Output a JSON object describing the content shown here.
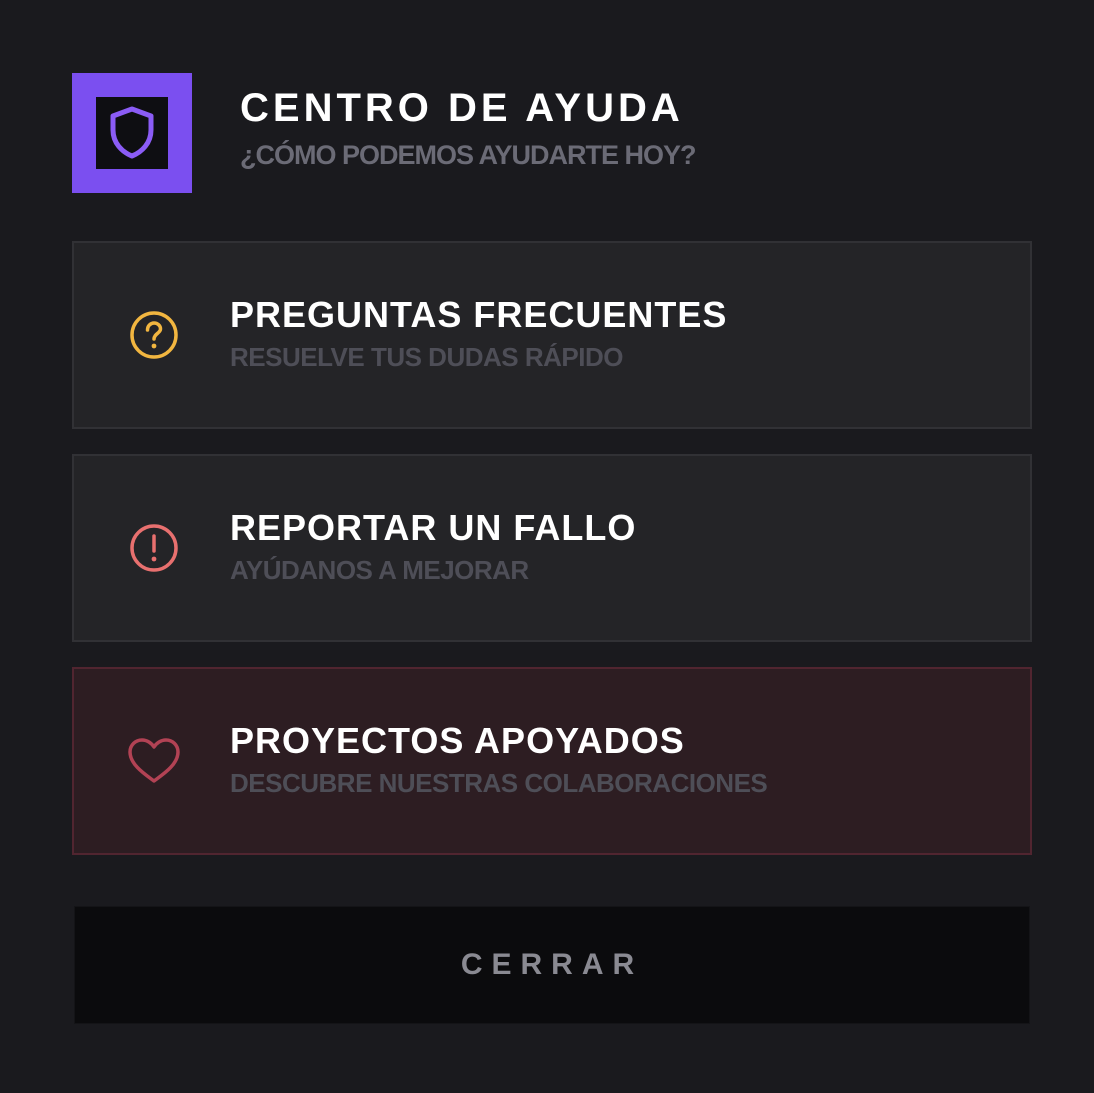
{
  "header": {
    "logo_icon": "shield-icon",
    "title": "CENTRO DE AYUDA",
    "subtitle": "¿CÓMO PODEMOS AYUDARTE HOY?"
  },
  "options": [
    {
      "icon": "question-circle-icon",
      "icon_color": "#f2b640",
      "title": "PREGUNTAS FRECUENTES",
      "description": "RESUELVE TUS DUDAS RÁPIDO"
    },
    {
      "icon": "alert-circle-icon",
      "icon_color": "#e8706f",
      "title": "REPORTAR UN FALLO",
      "description": "AYÚDANOS A MEJORAR"
    },
    {
      "icon": "heart-icon",
      "icon_color": "#b24254",
      "title": "PROYECTOS APOYADOS",
      "description": "DESCUBRE NUESTRAS COLABORACIONES"
    }
  ],
  "footer": {
    "close_label": "CERRAR"
  },
  "colors": {
    "accent": "#7b4ff0",
    "background": "#1a1a1e",
    "card": "#242427",
    "card_highlight": "#2d1d22"
  }
}
